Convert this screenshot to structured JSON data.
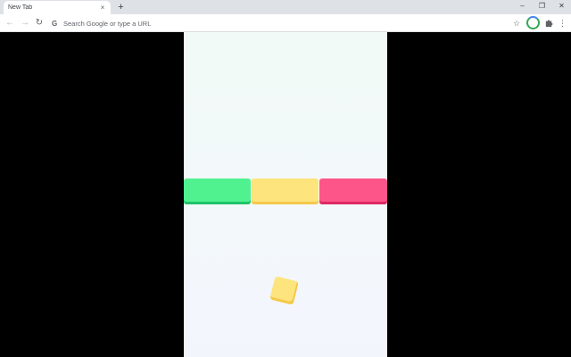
{
  "browser": {
    "tab_title": "New Tab",
    "tab_close": "×",
    "new_tab": "+",
    "controls": {
      "minimize": "–",
      "restore": "❐",
      "close": "✕"
    },
    "nav": {
      "back": "←",
      "forward": "→",
      "reload": "↻"
    },
    "omnibox_placeholder": "Search Google or type a URL",
    "omnibox_icon": "G",
    "bookmark_icon": "☆",
    "menu_icon": "⋮"
  },
  "game": {
    "bars": [
      {
        "color": "green",
        "hex": "#4ff28f"
      },
      {
        "color": "yellow",
        "hex": "#fde47d"
      },
      {
        "color": "red",
        "hex": "#fd5589"
      }
    ],
    "player": {
      "color": "yellow",
      "hex": "#fde47d"
    }
  }
}
